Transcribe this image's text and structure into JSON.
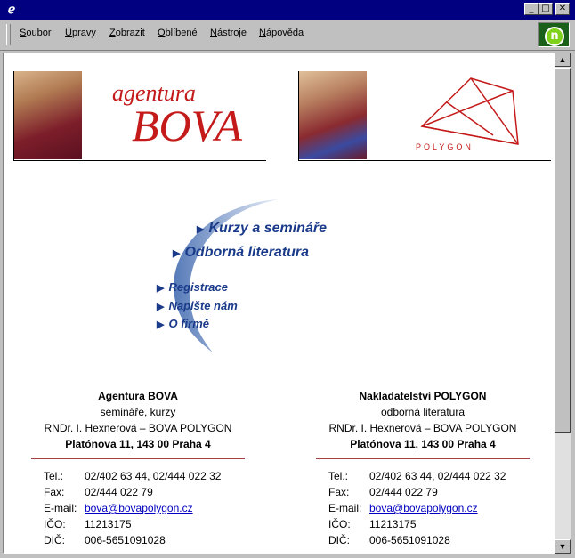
{
  "window": {
    "menu": [
      "Soubor",
      "Úpravy",
      "Zobrazit",
      "Oblíbené",
      "Nástroje",
      "Nápověda"
    ]
  },
  "banners": {
    "left": {
      "line1": "agentura",
      "line2": "BOVA"
    },
    "right": {
      "logo_text": "POLYGON"
    }
  },
  "nav": {
    "kurzy": "Kurzy a semináře",
    "literatura": "Odborná literatura",
    "registrace": "Registrace",
    "napiste": "Napište nám",
    "firma": "O firmě"
  },
  "left": {
    "name": "Agentura BOVA",
    "subtitle": "semináře, kurzy",
    "person": "RNDr. I. Hexnerová – BOVA POLYGON",
    "address": "Platónova 11, 143 00  Praha 4",
    "contacts": {
      "tel_label": "Tel.:",
      "tel": "02/402 63 44, 02/444 022 32",
      "fax_label": "Fax:",
      "fax": "02/444 022 79",
      "email_label": "E-mail:",
      "email": "bova@bovapolygon.cz",
      "ico_label": "IČO:",
      "ico": "11213175",
      "dic_label": "DIČ:",
      "dic": "006-5651091028"
    }
  },
  "right": {
    "name": "Nakladatelství POLYGON",
    "subtitle": "odborná literatura",
    "person": "RNDr. I. Hexnerová – BOVA POLYGON",
    "address": "Platónova 11, 143 00  Praha 4",
    "contacts": {
      "tel_label": "Tel.:",
      "tel": "02/402 63 44, 02/444 022 32",
      "fax_label": "Fax:",
      "fax": "02/444 022 79",
      "email_label": "E-mail:",
      "email": "bova@bovapolygon.cz",
      "ico_label": "IČO:",
      "ico": "11213175",
      "dic_label": "DIČ:",
      "dic": "006-5651091028"
    }
  },
  "colors": {
    "titlebar": "#000080",
    "brand_red": "#c41a1a",
    "nav_blue": "#1a3a8a",
    "link": "#0000c0"
  }
}
